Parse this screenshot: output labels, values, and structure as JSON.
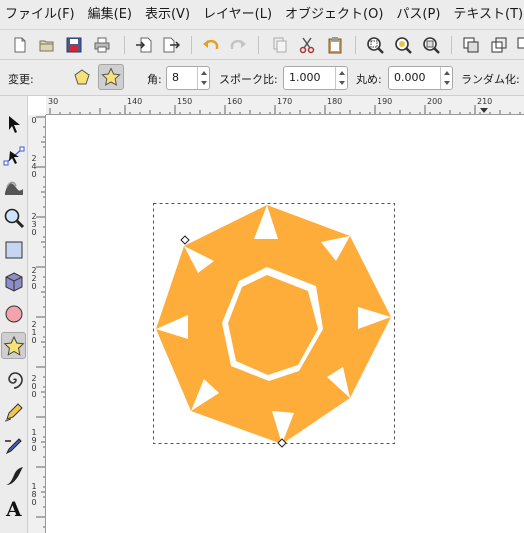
{
  "menubar": {
    "items": [
      "ファイル(F)",
      "編集(E)",
      "表示(V)",
      "レイヤー(L)",
      "オブジェクト(O)",
      "パス(P)",
      "テキスト(T)"
    ]
  },
  "command_bar": {
    "buttons": [
      "new-document-icon",
      "open-icon",
      "save-icon",
      "print-icon",
      "import-icon",
      "export-icon",
      "undo-icon",
      "redo-icon",
      "copy-icon",
      "cut-icon",
      "paste-icon",
      "zoom-selection-icon",
      "zoom-drawing-icon",
      "zoom-page-icon",
      "duplicate-icon",
      "clone-icon",
      "unlink-clone-icon"
    ]
  },
  "tool_controls": {
    "mode_label": "変更:",
    "mode_polygon_icon": "polygon-icon",
    "mode_star_icon": "star-icon",
    "mode_selected": "star",
    "corners_label": "角:",
    "corners_value": "8",
    "spoke_ratio_label": "スポーク比:",
    "spoke_ratio_value": "1.000",
    "rounded_label": "丸め:",
    "rounded_value": "0.000",
    "randomized_label": "ランダム化:"
  },
  "ruler": {
    "h_labels": [
      "30",
      "140",
      "150",
      "160",
      "170",
      "180",
      "190",
      "200",
      "210"
    ],
    "v_labels": [
      "0",
      "2 4 0",
      "2 3 0",
      "2 2 0",
      "2 1 0",
      "2 0 0",
      "1 9 0",
      "1 8 0"
    ]
  },
  "toolbox": {
    "tools": [
      "selector-tool",
      "node-tool",
      "tweak-tool",
      "zoom-tool",
      "rectangle-tool",
      "3d-box-tool",
      "ellipse-tool",
      "star-tool",
      "spiral-tool",
      "pencil-tool",
      "pen-tool",
      "calligraphy-tool",
      "text-tool"
    ],
    "active_tool": "star-tool"
  },
  "canvas": {
    "shape_fill": "#ffad3a",
    "selection_color": "#555555"
  }
}
